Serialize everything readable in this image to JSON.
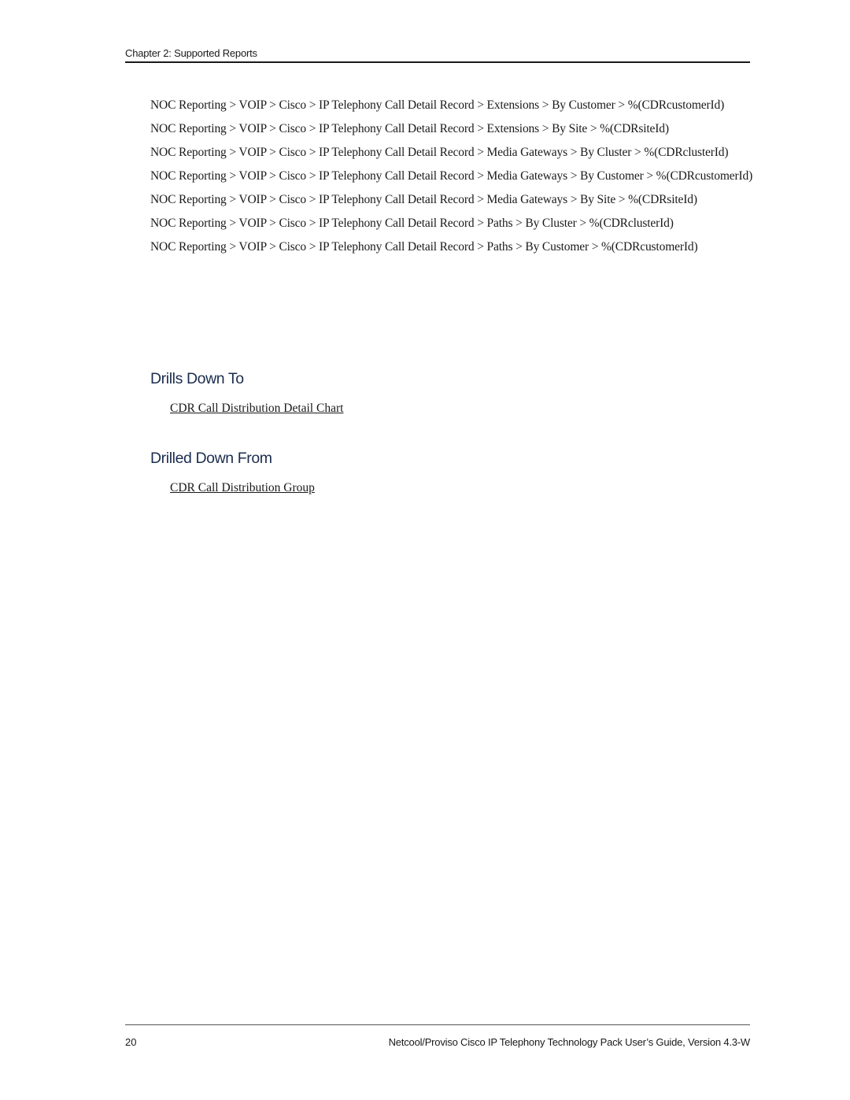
{
  "header": {
    "chapter_title": "Chapter 2: Supported Reports"
  },
  "navigation_paths": [
    "NOC Reporting > VOIP > Cisco > IP Telephony Call Detail Record > Extensions > By Customer > %(CDRcustomerId)",
    "NOC Reporting > VOIP > Cisco > IP Telephony Call Detail Record > Extensions > By Site > %(CDRsiteId)",
    "NOC Reporting > VOIP > Cisco > IP Telephony Call Detail Record > Media Gateways > By Cluster > %(CDRclusterId)",
    "NOC Reporting > VOIP > Cisco > IP Telephony Call Detail Record > Media Gateways > By Customer > %(CDRcustomerId)",
    "NOC Reporting > VOIP > Cisco > IP Telephony Call Detail Record > Media Gateways > By Site > %(CDRsiteId)",
    "NOC Reporting > VOIP > Cisco > IP Telephony Call Detail Record > Paths > By Cluster > %(CDRclusterId)",
    "NOC Reporting > VOIP > Cisco > IP Telephony Call Detail Record > Paths > By Customer > %(CDRcustomerId)"
  ],
  "sections": {
    "drills_down_to": {
      "heading": "Drills Down To",
      "link": "CDR Call Distribution Detail Chart"
    },
    "drilled_down_from": {
      "heading": "Drilled Down From",
      "link": "CDR Call Distribution Group"
    }
  },
  "footer": {
    "page_number": "20",
    "document_title": "Netcool/Proviso Cisco IP Telephony Technology Pack User’s Guide, Version 4.3-W"
  },
  "colors": {
    "heading": "#1b2d4f",
    "text": "#1a1a1a"
  }
}
